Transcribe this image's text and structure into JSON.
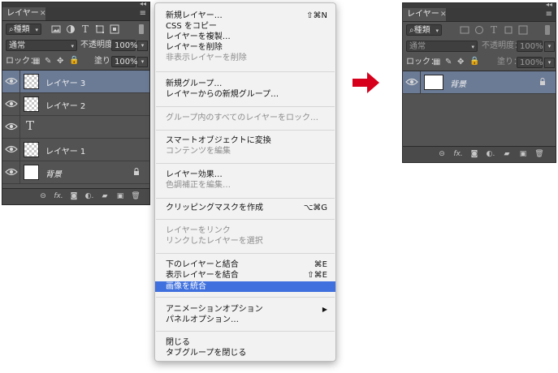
{
  "left_panel": {
    "tab": "レイヤー",
    "collapse_glyph": "◂◂",
    "close_glyph": "✕",
    "menu_glyph": "≡",
    "filter": {
      "label": "種類",
      "search_glyph": "⌕",
      "icons": [
        "image-filter-icon",
        "adjustment-filter-icon",
        "type-filter-icon",
        "shape-filter-icon",
        "smart-object-filter-icon"
      ]
    },
    "blend_mode": "通常",
    "opacity_label": "不透明度：",
    "opacity_value": "100%",
    "lock_label": "ロック：",
    "fill_label": "塗り：",
    "fill_value": "100%",
    "layers": [
      {
        "name": "レイヤー 3",
        "thumb": "checker",
        "selected": true
      },
      {
        "name": "レイヤー 2",
        "thumb": "checker",
        "selected": false
      },
      {
        "name": "",
        "thumb": "type",
        "type_glyph": "T",
        "selected": false
      },
      {
        "name": "レイヤー 1",
        "thumb": "checker",
        "selected": false
      },
      {
        "name": "背景",
        "thumb": "white",
        "selected": false,
        "locked": true
      }
    ],
    "bottom_glyphs": {
      "link": "⊝",
      "fx": "fx.",
      "mask": "◙",
      "adjust": "◐.",
      "folder": "▰",
      "new": "▣",
      "trash": "🗑"
    }
  },
  "menu": {
    "groups": [
      [
        {
          "label": "新規レイヤー…",
          "shortcut": "⇧⌘N",
          "enabled": true
        },
        {
          "label": "CSS をコピー",
          "shortcut": "",
          "enabled": true
        },
        {
          "label": "レイヤーを複製…",
          "shortcut": "",
          "enabled": true
        },
        {
          "label": "レイヤーを削除",
          "shortcut": "",
          "enabled": true
        },
        {
          "label": "非表示レイヤーを削除",
          "shortcut": "",
          "enabled": false
        }
      ],
      [
        {
          "label": "新規グループ…",
          "shortcut": "",
          "enabled": true
        },
        {
          "label": "レイヤーからの新規グループ…",
          "shortcut": "",
          "enabled": true
        }
      ],
      [
        {
          "label": "グループ内のすべてのレイヤーをロック…",
          "shortcut": "",
          "enabled": false
        }
      ],
      [
        {
          "label": "スマートオブジェクトに変換",
          "shortcut": "",
          "enabled": true
        },
        {
          "label": "コンテンツを編集",
          "shortcut": "",
          "enabled": false
        }
      ],
      [
        {
          "label": "レイヤー効果…",
          "shortcut": "",
          "enabled": true
        },
        {
          "label": "色調補正を編集…",
          "shortcut": "",
          "enabled": false
        }
      ],
      [
        {
          "label": "クリッピングマスクを作成",
          "shortcut": "⌥⌘G",
          "enabled": true
        }
      ],
      [
        {
          "label": "レイヤーをリンク",
          "shortcut": "",
          "enabled": false
        },
        {
          "label": "リンクしたレイヤーを選択",
          "shortcut": "",
          "enabled": false
        }
      ],
      [
        {
          "label": "下のレイヤーと結合",
          "shortcut": "⌘E",
          "enabled": true
        },
        {
          "label": "表示レイヤーを結合",
          "shortcut": "⇧⌘E",
          "enabled": true
        },
        {
          "label": "画像を統合",
          "shortcut": "",
          "enabled": true,
          "highlighted": true
        }
      ],
      [
        {
          "label": "アニメーションオプション",
          "shortcut": "▶",
          "enabled": true
        },
        {
          "label": "パネルオプション…",
          "shortcut": "",
          "enabled": true
        }
      ],
      [
        {
          "label": "閉じる",
          "shortcut": "",
          "enabled": true
        },
        {
          "label": "タブグループを閉じる",
          "shortcut": "",
          "enabled": true
        }
      ]
    ]
  },
  "right_panel": {
    "tab": "レイヤー",
    "collapse_glyph": "◂◂",
    "close_glyph": "✕",
    "menu_glyph": "≡",
    "filter": {
      "label": "種類",
      "search_glyph": "⌕"
    },
    "blend_mode": "通常",
    "opacity_label": "不透明度：",
    "opacity_value": "100%",
    "lock_label": "ロック：",
    "fill_label": "塗り：",
    "fill_value": "100%",
    "layers": [
      {
        "name": "背景",
        "thumb": "white",
        "selected": true,
        "locked": true
      }
    ]
  },
  "colors": {
    "panel_bg": "#535353",
    "selected_layer": "#6b7b96",
    "menu_highlight": "#3f70de",
    "arrow": "#d6001c"
  }
}
